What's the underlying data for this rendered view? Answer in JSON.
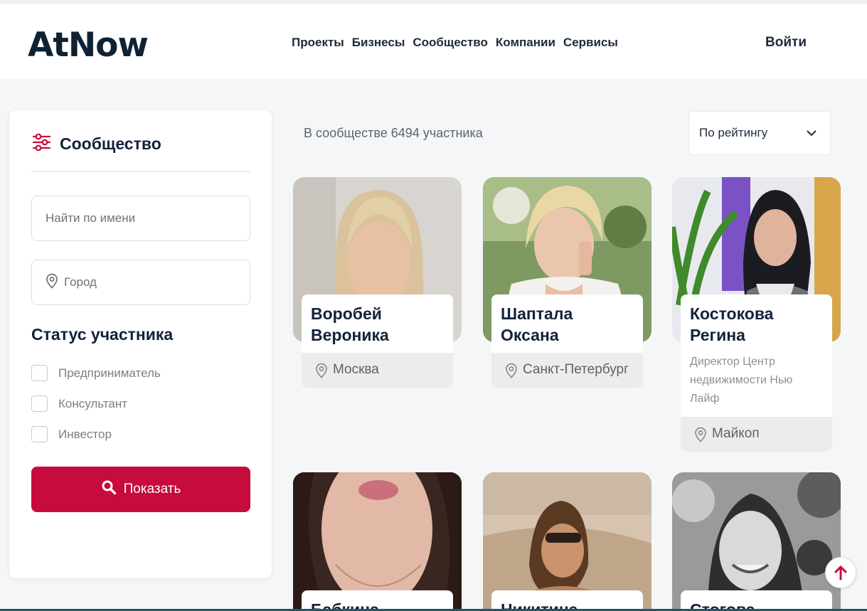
{
  "header": {
    "logo": "AtNow",
    "nav": [
      "Проекты",
      "Бизнесы",
      "Сообщество",
      "Компании",
      "Сервисы"
    ],
    "login": "Войти"
  },
  "sidebar": {
    "title": "Сообщество",
    "title_icon": "sliders-icon",
    "search_placeholder": "Найти по имени",
    "city_placeholder": "Город",
    "status_title": "Статус участника",
    "statuses": [
      "Предприниматель",
      "Консультант",
      "Инвестор"
    ],
    "show_button": "Показать"
  },
  "main": {
    "count_text": "В сообществе 6494 участника",
    "sort_value": "По рейтингу",
    "cards": [
      {
        "name": "Воробей Вероника",
        "role": "",
        "city": "Москва"
      },
      {
        "name": "Шаптала Оксана",
        "role": "",
        "city": "Санкт-Петербург"
      },
      {
        "name": "Костокова Регина",
        "role": "Директор Центр недвижимости Нью Лайф",
        "city": "Майкоп"
      },
      {
        "name": "Бабкина",
        "role": "",
        "city": ""
      },
      {
        "name": "Никитина",
        "role": "",
        "city": ""
      },
      {
        "name": "Стогова",
        "role": "",
        "city": ""
      }
    ]
  },
  "colors": {
    "accent": "#c70b3c",
    "dark": "#13223a",
    "background": "#f5f6f8"
  }
}
